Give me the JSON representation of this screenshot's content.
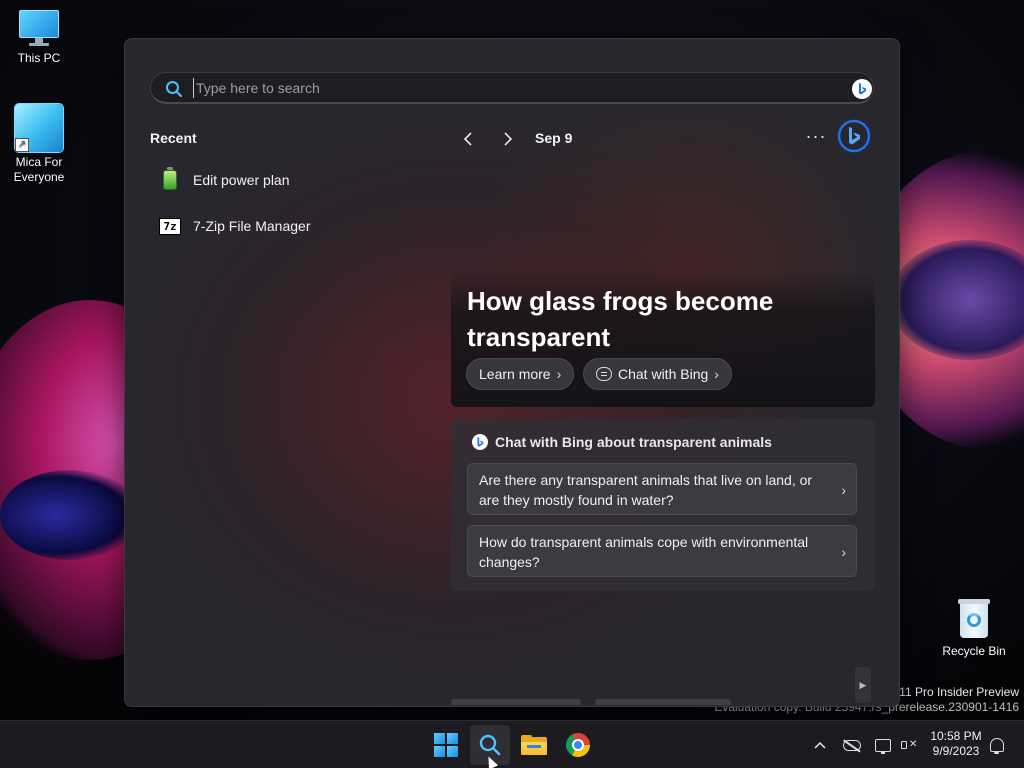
{
  "desktop": {
    "icons": [
      {
        "label": "This PC"
      },
      {
        "label": "Mica For Everyone"
      },
      {
        "label": "Recycle Bin"
      }
    ],
    "watermark": {
      "line1": "11 Pro Insider Preview",
      "line2": "Evaluation copy. Build 25947.rs_prerelease.230901-1416"
    }
  },
  "search": {
    "placeholder": "Type here to search",
    "value": ""
  },
  "recent": {
    "title": "Recent",
    "items": [
      {
        "label": "Edit power plan",
        "icon": "battery-icon"
      },
      {
        "label": "7-Zip File Manager",
        "icon": "7zip-icon",
        "icon_text": "7z"
      }
    ]
  },
  "highlights": {
    "date": "Sep 9",
    "more_glyph": "···",
    "hero": {
      "title": "How glass frogs become transparent",
      "learn_more": "Learn more",
      "chat_with_bing": "Chat with Bing"
    },
    "chat_card": {
      "heading": "Chat with Bing about transparent animals",
      "questions": [
        "Are there any transparent animals that live on land, or are they mostly found in water?",
        "How do transparent animals cope with environmental changes?"
      ]
    }
  },
  "taskbar": {
    "apps": [
      "start",
      "search",
      "file-explorer",
      "chrome"
    ],
    "clock": {
      "time": "10:58 PM",
      "date": "9/9/2023"
    }
  },
  "colors": {
    "accent": "#0a84ff",
    "bing_blue": "#1a73e8",
    "flyout_bg": "#28272d",
    "taskbar_bg": "#1c1c20"
  }
}
